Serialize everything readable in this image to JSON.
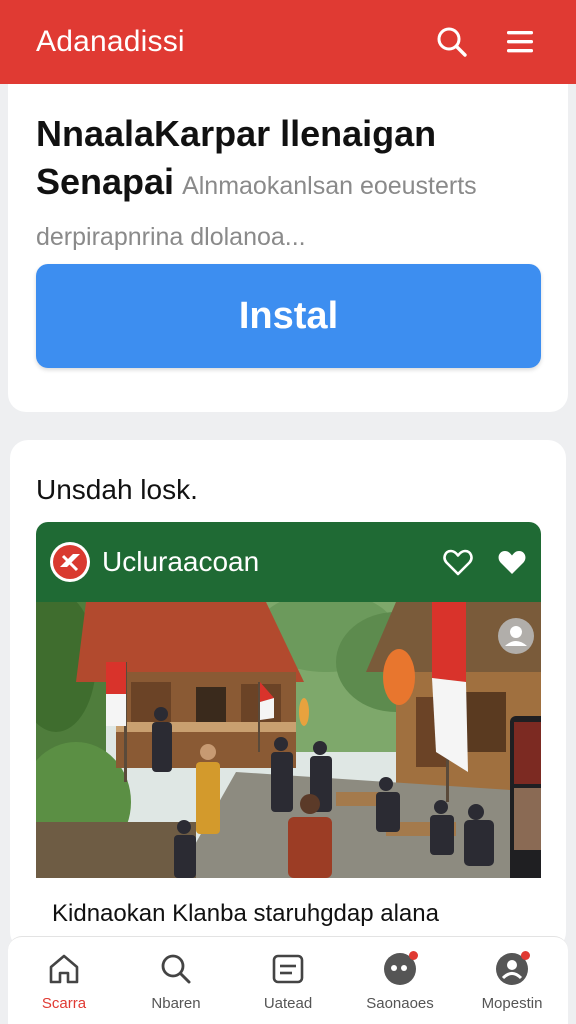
{
  "app": {
    "title": "Adanadissi"
  },
  "topbar": {
    "icons": [
      "search-icon",
      "menu-icon"
    ],
    "color": "#e03a33"
  },
  "promo": {
    "headline_line1": "NnaalaKarpar llenaigan",
    "headline_line2": "Senapai",
    "subtitle_inline": "Alnmaokanlsan eoeusterts",
    "subtitle_line2": "derpirapnrina dlolanoa...",
    "install_label": "Instal",
    "button_color": "#3d8ef0"
  },
  "feed": {
    "section_title": "Unsdah losk.",
    "post": {
      "channel_name": "Ucluraacoan",
      "caption": "Kidnaokan Klanba staruhgdap alana",
      "icons": [
        "channel-logo-icon",
        "heart-outline-icon",
        "heart-filled-icon",
        "avatar-icon"
      ],
      "header_color": "#1f6a34"
    }
  },
  "bottom_nav": {
    "items": [
      {
        "label": "Scarra",
        "icon": "home-icon",
        "active": true
      },
      {
        "label": "Nbaren",
        "icon": "search-icon",
        "active": false
      },
      {
        "label": "Uatead",
        "icon": "list-icon",
        "active": false
      },
      {
        "label": "Saonaoes",
        "icon": "chat-icon",
        "active": false
      },
      {
        "label": "Mopestin",
        "icon": "profile-icon",
        "active": false
      }
    ]
  }
}
